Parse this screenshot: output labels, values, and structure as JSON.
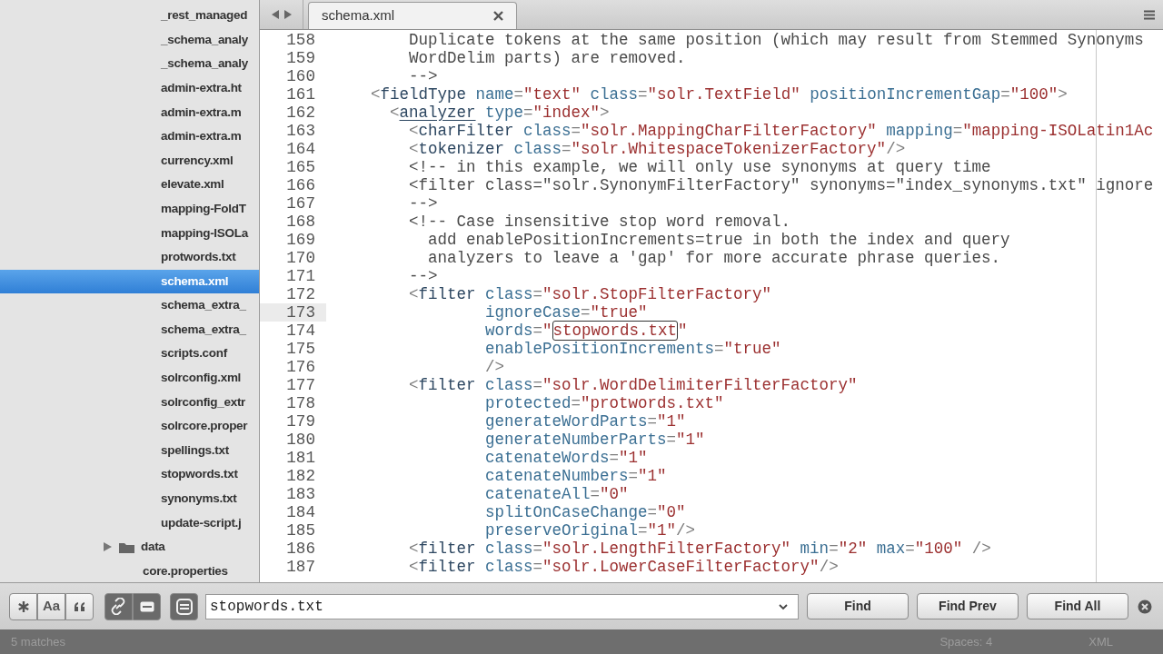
{
  "sidebar": {
    "nested_files": [
      {
        "label": "_rest_managed",
        "selected": false
      },
      {
        "label": "_schema_analy",
        "selected": false
      },
      {
        "label": "_schema_analy",
        "selected": false
      },
      {
        "label": "admin-extra.ht",
        "selected": false
      },
      {
        "label": "admin-extra.m",
        "selected": false
      },
      {
        "label": "admin-extra.m",
        "selected": false
      },
      {
        "label": "currency.xml",
        "selected": false
      },
      {
        "label": "elevate.xml",
        "selected": false
      },
      {
        "label": "mapping-FoldT",
        "selected": false
      },
      {
        "label": "mapping-ISOLa",
        "selected": false
      },
      {
        "label": "protwords.txt",
        "selected": false
      },
      {
        "label": "schema.xml",
        "selected": true
      },
      {
        "label": "schema_extra_",
        "selected": false
      },
      {
        "label": "schema_extra_",
        "selected": false
      },
      {
        "label": "scripts.conf",
        "selected": false
      },
      {
        "label": "solrconfig.xml",
        "selected": false
      },
      {
        "label": "solrconfig_extr",
        "selected": false
      },
      {
        "label": "solrcore.proper",
        "selected": false
      },
      {
        "label": "spellings.txt",
        "selected": false
      },
      {
        "label": "stopwords.txt",
        "selected": false
      },
      {
        "label": "synonyms.txt",
        "selected": false
      },
      {
        "label": "update-script.j",
        "selected": false
      }
    ],
    "items": [
      {
        "label": "data",
        "kind": "folder",
        "expanded": false,
        "selected": false
      },
      {
        "label": "core.properties",
        "kind": "file",
        "selected": false
      }
    ]
  },
  "tabs": [
    {
      "label": "schema.xml",
      "selected": true
    }
  ],
  "editor": {
    "lines": [
      {
        "number": "158",
        "current": false,
        "tokens": [
          {
            "kind": "comment",
            "text": "        Duplicate tokens at the same position (which may result from Stemmed Synonyms"
          }
        ]
      },
      {
        "number": "159",
        "current": false,
        "tokens": [
          {
            "kind": "comment",
            "text": "        WordDelim parts) are removed."
          }
        ]
      },
      {
        "number": "160",
        "current": false,
        "tokens": [
          {
            "kind": "comment",
            "text": "        -->"
          }
        ]
      },
      {
        "number": "161",
        "current": false,
        "tokens": [
          {
            "kind": "punct",
            "text": "    <"
          },
          {
            "kind": "tag",
            "text": "fieldType"
          },
          {
            "kind": "attr",
            "text": " name"
          },
          {
            "kind": "punct",
            "text": "="
          },
          {
            "kind": "string",
            "text": "\"text\""
          },
          {
            "kind": "attr",
            "text": " class"
          },
          {
            "kind": "punct",
            "text": "="
          },
          {
            "kind": "string",
            "text": "\"solr.TextField\""
          },
          {
            "kind": "attr",
            "text": " positionIncrementGap"
          },
          {
            "kind": "punct",
            "text": "="
          },
          {
            "kind": "string",
            "text": "\"100\""
          },
          {
            "kind": "punct",
            "text": ">"
          }
        ]
      },
      {
        "number": "162",
        "current": false,
        "tokens": [
          {
            "kind": "punct",
            "text": "      <"
          },
          {
            "kind": "tag_matched",
            "text": "analyzer"
          },
          {
            "kind": "attr",
            "text": " type"
          },
          {
            "kind": "punct",
            "text": "="
          },
          {
            "kind": "string",
            "text": "\"index\""
          },
          {
            "kind": "punct",
            "text": ">"
          }
        ]
      },
      {
        "number": "163",
        "current": false,
        "tokens": [
          {
            "kind": "punct",
            "text": "        <"
          },
          {
            "kind": "tag",
            "text": "charFilter"
          },
          {
            "kind": "attr",
            "text": " class"
          },
          {
            "kind": "punct",
            "text": "="
          },
          {
            "kind": "string",
            "text": "\"solr.MappingCharFilterFactory\""
          },
          {
            "kind": "attr",
            "text": " mapping"
          },
          {
            "kind": "punct",
            "text": "="
          },
          {
            "kind": "string",
            "text": "\"mapping-ISOLatin1Ac"
          }
        ]
      },
      {
        "number": "164",
        "current": false,
        "tokens": [
          {
            "kind": "punct",
            "text": "        <"
          },
          {
            "kind": "tag",
            "text": "tokenizer"
          },
          {
            "kind": "attr",
            "text": " class"
          },
          {
            "kind": "punct",
            "text": "="
          },
          {
            "kind": "string",
            "text": "\"solr.WhitespaceTokenizerFactory\""
          },
          {
            "kind": "punct",
            "text": "/>"
          }
        ]
      },
      {
        "number": "165",
        "current": false,
        "tokens": [
          {
            "kind": "comment",
            "text": "        <!-- in this example, we will only use synonyms at query time"
          }
        ]
      },
      {
        "number": "166",
        "current": false,
        "tokens": [
          {
            "kind": "comment",
            "text": "        <filter class=\"solr.SynonymFilterFactory\" synonyms=\"index_synonyms.txt\" ignore"
          }
        ]
      },
      {
        "number": "167",
        "current": false,
        "tokens": [
          {
            "kind": "comment",
            "text": "        -->"
          }
        ]
      },
      {
        "number": "168",
        "current": false,
        "tokens": [
          {
            "kind": "comment",
            "text": "        <!-- Case insensitive stop word removal."
          }
        ]
      },
      {
        "number": "169",
        "current": false,
        "tokens": [
          {
            "kind": "comment",
            "text": "          add enablePositionIncrements=true in both the index and query"
          }
        ]
      },
      {
        "number": "170",
        "current": false,
        "tokens": [
          {
            "kind": "comment",
            "text": "          analyzers to leave a 'gap' for more accurate phrase queries."
          }
        ]
      },
      {
        "number": "171",
        "current": false,
        "tokens": [
          {
            "kind": "comment",
            "text": "        -->"
          }
        ]
      },
      {
        "number": "172",
        "current": false,
        "tokens": [
          {
            "kind": "punct",
            "text": "        <"
          },
          {
            "kind": "tag",
            "text": "filter"
          },
          {
            "kind": "attr",
            "text": " class"
          },
          {
            "kind": "punct",
            "text": "="
          },
          {
            "kind": "string",
            "text": "\"solr.StopFilterFactory\""
          }
        ]
      },
      {
        "number": "173",
        "current": true,
        "tokens": [
          {
            "kind": "attr",
            "text": "                ignoreCase"
          },
          {
            "kind": "punct",
            "text": "="
          },
          {
            "kind": "string",
            "text": "\"true\""
          }
        ]
      },
      {
        "number": "174",
        "current": false,
        "tokens": [
          {
            "kind": "attr",
            "text": "                words"
          },
          {
            "kind": "punct",
            "text": "="
          },
          {
            "kind": "string",
            "text": "\""
          },
          {
            "kind": "match",
            "text": "stopwords.txt"
          },
          {
            "kind": "string",
            "text": "\""
          }
        ]
      },
      {
        "number": "175",
        "current": false,
        "tokens": [
          {
            "kind": "attr",
            "text": "                enablePositionIncrements"
          },
          {
            "kind": "punct",
            "text": "="
          },
          {
            "kind": "string",
            "text": "\"true\""
          }
        ]
      },
      {
        "number": "176",
        "current": false,
        "tokens": [
          {
            "kind": "punct",
            "text": "                />"
          }
        ]
      },
      {
        "number": "177",
        "current": false,
        "tokens": [
          {
            "kind": "punct",
            "text": "        <"
          },
          {
            "kind": "tag",
            "text": "filter"
          },
          {
            "kind": "attr",
            "text": " class"
          },
          {
            "kind": "punct",
            "text": "="
          },
          {
            "kind": "string",
            "text": "\"solr.WordDelimiterFilterFactory\""
          }
        ]
      },
      {
        "number": "178",
        "current": false,
        "tokens": [
          {
            "kind": "attr",
            "text": "                protected"
          },
          {
            "kind": "punct",
            "text": "="
          },
          {
            "kind": "string",
            "text": "\"protwords.txt\""
          }
        ]
      },
      {
        "number": "179",
        "current": false,
        "tokens": [
          {
            "kind": "attr",
            "text": "                generateWordParts"
          },
          {
            "kind": "punct",
            "text": "="
          },
          {
            "kind": "string",
            "text": "\"1\""
          }
        ]
      },
      {
        "number": "180",
        "current": false,
        "tokens": [
          {
            "kind": "attr",
            "text": "                generateNumberParts"
          },
          {
            "kind": "punct",
            "text": "="
          },
          {
            "kind": "string",
            "text": "\"1\""
          }
        ]
      },
      {
        "number": "181",
        "current": false,
        "tokens": [
          {
            "kind": "attr",
            "text": "                catenateWords"
          },
          {
            "kind": "punct",
            "text": "="
          },
          {
            "kind": "string",
            "text": "\"1\""
          }
        ]
      },
      {
        "number": "182",
        "current": false,
        "tokens": [
          {
            "kind": "attr",
            "text": "                catenateNumbers"
          },
          {
            "kind": "punct",
            "text": "="
          },
          {
            "kind": "string",
            "text": "\"1\""
          }
        ]
      },
      {
        "number": "183",
        "current": false,
        "tokens": [
          {
            "kind": "attr",
            "text": "                catenateAll"
          },
          {
            "kind": "punct",
            "text": "="
          },
          {
            "kind": "string",
            "text": "\"0\""
          }
        ]
      },
      {
        "number": "184",
        "current": false,
        "tokens": [
          {
            "kind": "attr",
            "text": "                splitOnCaseChange"
          },
          {
            "kind": "punct",
            "text": "="
          },
          {
            "kind": "string",
            "text": "\"0\""
          }
        ]
      },
      {
        "number": "185",
        "current": false,
        "tokens": [
          {
            "kind": "attr",
            "text": "                preserveOriginal"
          },
          {
            "kind": "punct",
            "text": "="
          },
          {
            "kind": "string",
            "text": "\"1\""
          },
          {
            "kind": "punct",
            "text": "/>"
          }
        ]
      },
      {
        "number": "186",
        "current": false,
        "tokens": [
          {
            "kind": "punct",
            "text": "        <"
          },
          {
            "kind": "tag",
            "text": "filter"
          },
          {
            "kind": "attr",
            "text": " class"
          },
          {
            "kind": "punct",
            "text": "="
          },
          {
            "kind": "string",
            "text": "\"solr.LengthFilterFactory\""
          },
          {
            "kind": "attr",
            "text": " min"
          },
          {
            "kind": "punct",
            "text": "="
          },
          {
            "kind": "string",
            "text": "\"2\""
          },
          {
            "kind": "attr",
            "text": " max"
          },
          {
            "kind": "punct",
            "text": "="
          },
          {
            "kind": "string",
            "text": "\"100\""
          },
          {
            "kind": "punct",
            "text": " />"
          }
        ]
      },
      {
        "number": "187",
        "current": false,
        "tokens": [
          {
            "kind": "punct",
            "text": "        <"
          },
          {
            "kind": "tag",
            "text": "filter"
          },
          {
            "kind": "attr",
            "text": " class"
          },
          {
            "kind": "punct",
            "text": "="
          },
          {
            "kind": "string",
            "text": "\"solr.LowerCaseFilterFactory\""
          },
          {
            "kind": "punct",
            "text": "/>"
          }
        ]
      }
    ]
  },
  "find_bar": {
    "toggles": [
      {
        "kind": "regex",
        "on": false
      },
      {
        "kind": "case",
        "label": "Aa",
        "on": false
      },
      {
        "kind": "word",
        "on": false
      },
      {
        "kind": "wrap",
        "on": true
      },
      {
        "kind": "selection",
        "on": true
      },
      {
        "kind": "highlight",
        "on": true
      }
    ],
    "query": "stopwords.txt",
    "buttons": [
      "Find",
      "Find Prev",
      "Find All"
    ]
  },
  "status_bar": {
    "message": "5 matches",
    "indentation": "Spaces: 4",
    "syntax": "XML"
  }
}
